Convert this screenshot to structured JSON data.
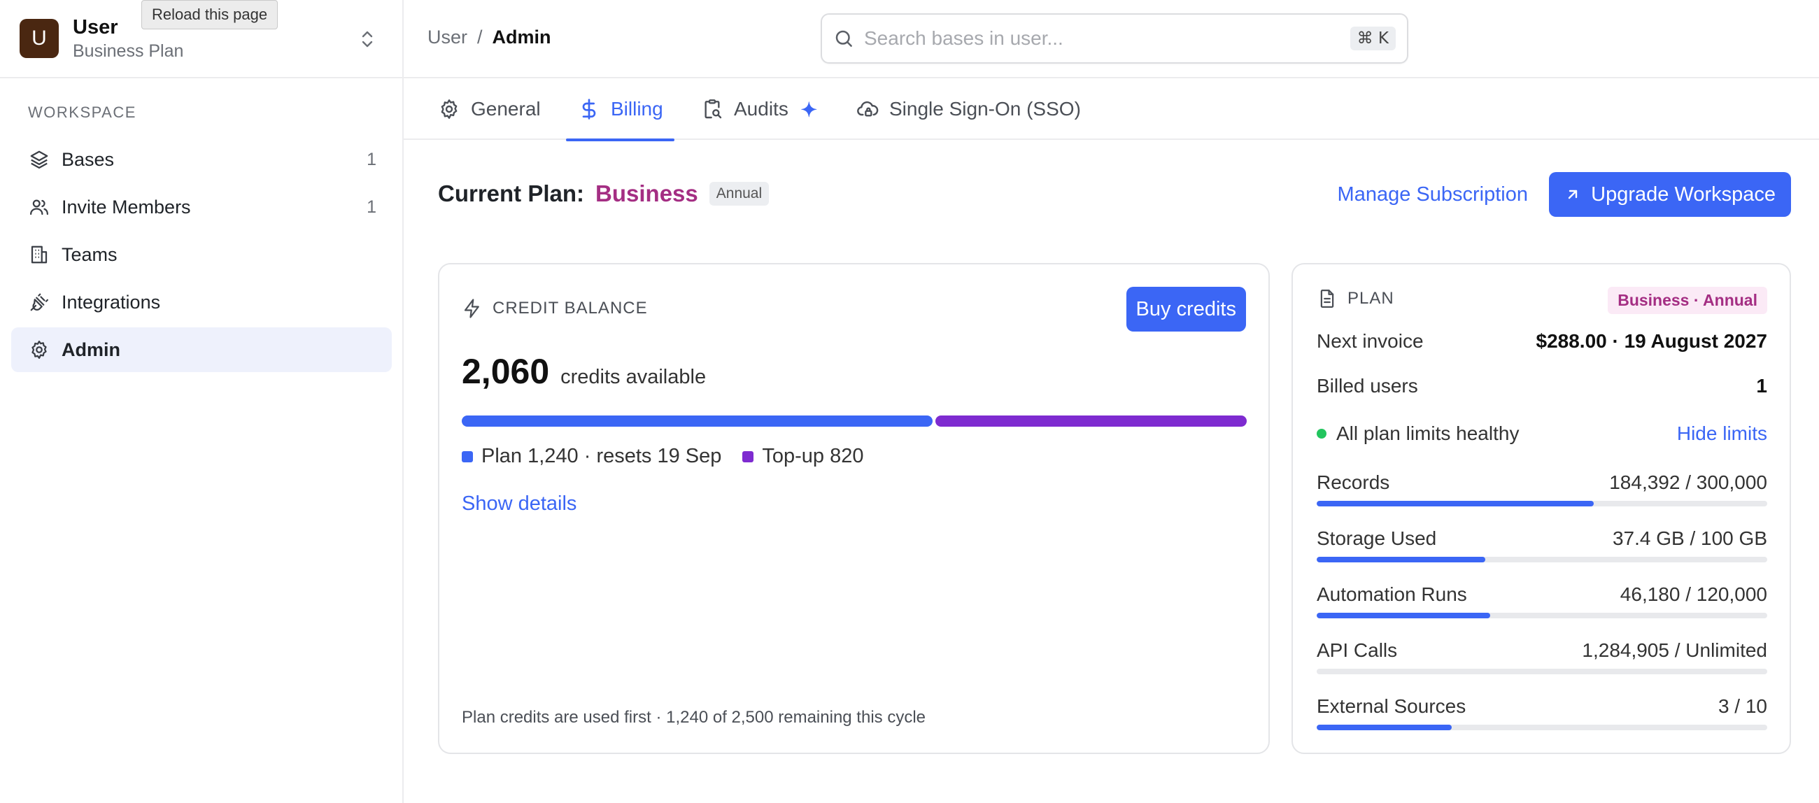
{
  "workspace": {
    "avatar_letter": "U",
    "name": "User",
    "plan": "Business Plan"
  },
  "tooltip": "Reload this page",
  "sidebar": {
    "section_label": "WORKSPACE",
    "items": [
      {
        "label": "Bases",
        "count": "1",
        "icon": "layers-icon",
        "active": false
      },
      {
        "label": "Invite Members",
        "count": "1",
        "icon": "users-icon",
        "active": false
      },
      {
        "label": "Teams",
        "count": "",
        "icon": "building-icon",
        "active": false
      },
      {
        "label": "Integrations",
        "count": "",
        "icon": "plug-icon",
        "active": false
      },
      {
        "label": "Admin",
        "count": "",
        "icon": "gear-icon",
        "active": true
      }
    ]
  },
  "breadcrumb": {
    "root": "User",
    "separator": "/",
    "current": "Admin"
  },
  "search": {
    "placeholder": "Search bases in user...",
    "shortcut": "⌘ K"
  },
  "tabs": [
    {
      "label": "General",
      "icon": "gear-icon",
      "active": false
    },
    {
      "label": "Billing",
      "icon": "dollar-icon",
      "active": true
    },
    {
      "label": "Audits",
      "icon": "clipboard-search-icon",
      "active": false
    },
    {
      "label": "Single Sign-On (SSO)",
      "icon": "cloud-lock-icon",
      "active": false
    }
  ],
  "plan_header": {
    "label": "Current Plan:",
    "plan_name": "Business",
    "cycle": "Annual",
    "manage_label": "Manage Subscription",
    "upgrade_label": "Upgrade Workspace"
  },
  "credit_balance": {
    "title": "CREDIT BALANCE",
    "buy_label": "Buy credits",
    "amount": "2,060",
    "amount_label": "credits available",
    "plan_credits": 1240,
    "topup_credits": 820,
    "legend_plan": "Plan 1,240 · resets 19 Sep",
    "legend_topup": "Top-up 820",
    "show_details": "Show details",
    "footnote": "Plan credits are used first · 1,240 of 2,500 remaining this cycle"
  },
  "plan_card": {
    "title": "PLAN",
    "badge": "Business · Annual",
    "next_invoice_label": "Next invoice",
    "next_invoice_value": "$288.00 · 19 August 2027",
    "billed_users_label": "Billed users",
    "billed_users_value": "1",
    "health_text": "All plan limits healthy",
    "hide_limits": "Hide limits",
    "limits": [
      {
        "label": "Records",
        "value": "184,392 / 300,000",
        "fraction": 0.6146
      },
      {
        "label": "Storage Used",
        "value": "37.4 GB / 100 GB",
        "fraction": 0.374
      },
      {
        "label": "Automation Runs",
        "value": "46,180 / 120,000",
        "fraction": 0.3848
      },
      {
        "label": "API Calls",
        "value": "1,284,905 / Unlimited",
        "fraction": 0
      },
      {
        "label": "External Sources",
        "value": "3 / 10",
        "fraction": 0.3
      }
    ]
  },
  "colors": {
    "accent": "#3b66f5",
    "plan_name": "#a42e83",
    "topup": "#7e2bd0",
    "healthy": "#22c55e"
  }
}
